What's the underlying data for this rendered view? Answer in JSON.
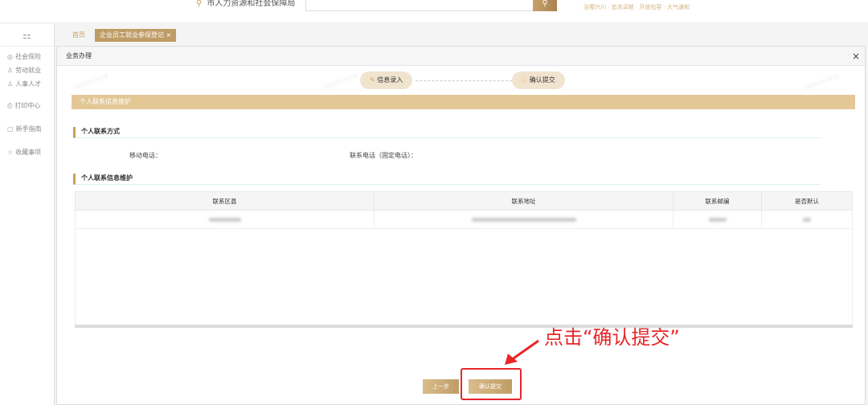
{
  "header": {
    "org_name": "市人力资源和社会保障局",
    "search_icon": "search-icon",
    "slogan": "治蜀兴川 · 追求卓越 · 开放包容 · 大气谦和"
  },
  "sidebar": {
    "items": [
      {
        "label": "社会保险",
        "icon": "globe-icon"
      },
      {
        "label": "劳动就业",
        "icon": "user-icon"
      },
      {
        "label": "人事人才",
        "icon": "users-icon"
      },
      {
        "label": "打印中心",
        "icon": "printer-icon"
      },
      {
        "label": "新手指南",
        "icon": "guide-icon"
      },
      {
        "label": "收藏事项",
        "icon": "star-icon"
      }
    ]
  },
  "tabs": {
    "home": "首页",
    "active": "企业员工就业参保登记"
  },
  "panel": {
    "title": "业务办理",
    "steps": [
      "信息录入",
      "确认提交"
    ],
    "banner": "个人联系信息维护",
    "section1": "个人联系方式",
    "mobile_label": "移动电话：",
    "landline_label": "联系电话（固定电话）：",
    "section2": "个人联系信息维护",
    "table": {
      "headers": [
        "联系区县",
        "联系地址",
        "联系邮编",
        "是否默认"
      ]
    },
    "prev_button": "上一步",
    "submit_button": "确认提交"
  },
  "annotation": "点击“确认提交”",
  "watermark": "0001057878",
  "colors": {
    "accent": "#c9a15a",
    "banner": "#e3c896",
    "annotation": "#e8262a"
  }
}
